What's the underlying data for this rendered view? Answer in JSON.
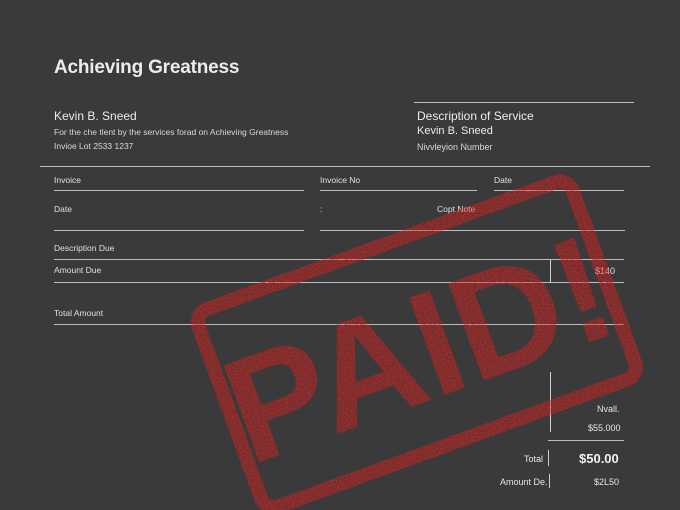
{
  "document": {
    "title": "Achieving Greatness",
    "client": {
      "name": "Kevin B. Sneed",
      "line1": "For the che tlent by the services forad on Achieving Greatness",
      "line2": "Invioe Lot 2533 1237"
    },
    "service": {
      "heading": "Description of Service",
      "name": "Kevin B. Sneed",
      "number_label": "Nivvleyion Number"
    },
    "fields": {
      "invoice": "Invoice",
      "invoice_no": "Invoice No",
      "date_top": "Date",
      "date": "Date",
      "colon": ":",
      "copt_note": "Copt Note",
      "description_due": "Description Due",
      "amount_due": "Amount Due",
      "amount_due_value": "$140",
      "total_amount": "Total Amount"
    },
    "summary": {
      "nvall_label": "Nvall.",
      "nvall_value": "$55.000",
      "total_label": "Total",
      "total_value": "$50.00",
      "amount_due_label": "Amount De.",
      "amount_due_value": "$2L50"
    },
    "stamp": {
      "text": "PAID!",
      "color": "#e01e1e"
    }
  }
}
